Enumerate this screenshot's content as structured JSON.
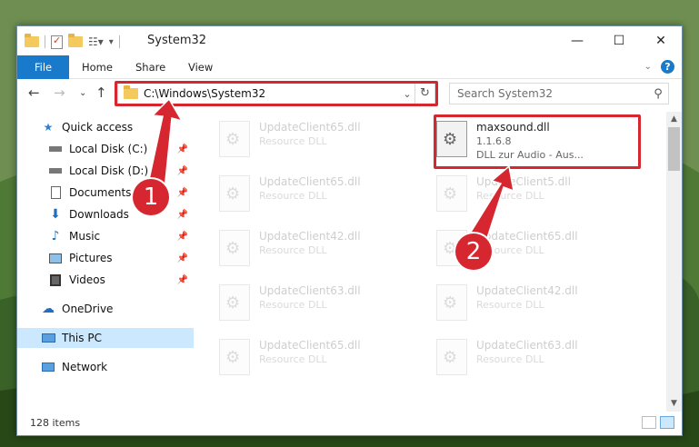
{
  "window": {
    "title": "System32"
  },
  "ribbon": {
    "tabs": [
      {
        "label": "File"
      },
      {
        "label": "Home"
      },
      {
        "label": "Share"
      },
      {
        "label": "View"
      }
    ]
  },
  "navbar": {
    "address_path": "C:\\Windows\\System32",
    "search_placeholder": "Search System32"
  },
  "sidebar": {
    "items": [
      {
        "label": "Quick access",
        "icon": "star-icon"
      },
      {
        "label": "Local Disk (C:)",
        "icon": "drive-icon",
        "pinned": true
      },
      {
        "label": "Local Disk (D:)",
        "icon": "drive-icon",
        "pinned": true
      },
      {
        "label": "Documents",
        "icon": "documents-icon",
        "pinned": true
      },
      {
        "label": "Downloads",
        "icon": "download-icon",
        "pinned": true
      },
      {
        "label": "Music",
        "icon": "music-icon",
        "pinned": true
      },
      {
        "label": "Pictures",
        "icon": "pictures-icon",
        "pinned": true
      },
      {
        "label": "Videos",
        "icon": "videos-icon",
        "pinned": true
      },
      {
        "label": "OneDrive",
        "icon": "cloud-icon"
      },
      {
        "label": "This PC",
        "icon": "computer-icon",
        "selected": true
      },
      {
        "label": "Network",
        "icon": "network-icon"
      }
    ]
  },
  "files": {
    "left": [
      {
        "name": "UpdateClient65.dll",
        "type": "Resource DLL"
      },
      {
        "name": "UpdateClient65.dll",
        "type": "Resource DLL"
      },
      {
        "name": "UpdateClient42.dll",
        "type": "Resource DLL"
      },
      {
        "name": "UpdateClient63.dll",
        "type": "Resource DLL"
      },
      {
        "name": "UpdateClient65.dll",
        "type": "Resource DLL"
      }
    ],
    "right": [
      {
        "name": "maxsound.dll",
        "version": "1.1.6.8",
        "type": "DLL zur Audio - Aus..."
      },
      {
        "name": "UpdateClient5.dll",
        "type": "Resource DLL"
      },
      {
        "name": "UpdateClient65.dll",
        "type": "Resource DLL"
      },
      {
        "name": "UpdateClient42.dll",
        "type": "Resource DLL"
      },
      {
        "name": "UpdateClient63.dll",
        "type": "Resource DLL"
      }
    ]
  },
  "status": {
    "item_count": "128 items"
  },
  "callouts": [
    {
      "label": "1"
    },
    {
      "label": "2"
    }
  ],
  "colors": {
    "accent": "#1979ca",
    "highlight": "#d6262f",
    "selection": "#cce8ff"
  }
}
